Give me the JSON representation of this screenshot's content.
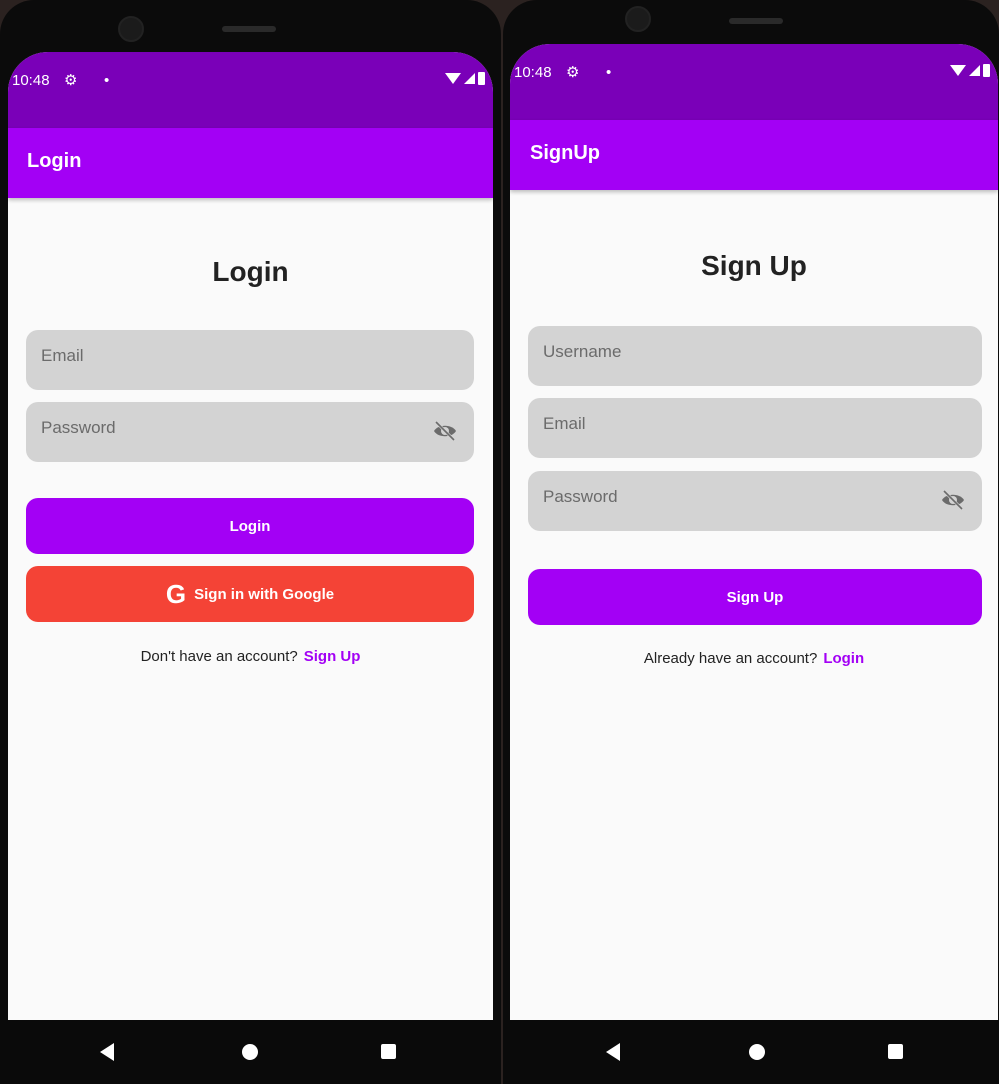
{
  "login_screen": {
    "status": {
      "time": "10:48",
      "gear": "⚙",
      "dot": "•"
    },
    "appbar_title": "Login",
    "heading": "Login",
    "email_placeholder": "Email",
    "password_placeholder": "Password",
    "login_button": "Login",
    "google_button": "Sign in with Google",
    "google_icon": "G",
    "footer_text": "Don't have an account?",
    "footer_link": "Sign Up"
  },
  "signup_screen": {
    "status": {
      "time": "10:48",
      "gear": "⚙",
      "dot": "•"
    },
    "appbar_title": "SignUp",
    "heading": "Sign Up",
    "username_placeholder": "Username",
    "email_placeholder": "Email",
    "password_placeholder": "Password",
    "signup_button": "Sign Up",
    "footer_text": "Already have an account?",
    "footer_link": "Login"
  },
  "colors": {
    "status_bar": "#7a00b8",
    "app_bar": "#a300f5",
    "primary_button": "#a300f5",
    "google_button": "#f44336",
    "field_bg": "#d3d3d3"
  },
  "icons": [
    "gear-icon",
    "wifi-icon",
    "signal-icon",
    "battery-icon",
    "eye-off-icon",
    "google-icon",
    "back-icon",
    "home-icon",
    "recents-icon"
  ]
}
